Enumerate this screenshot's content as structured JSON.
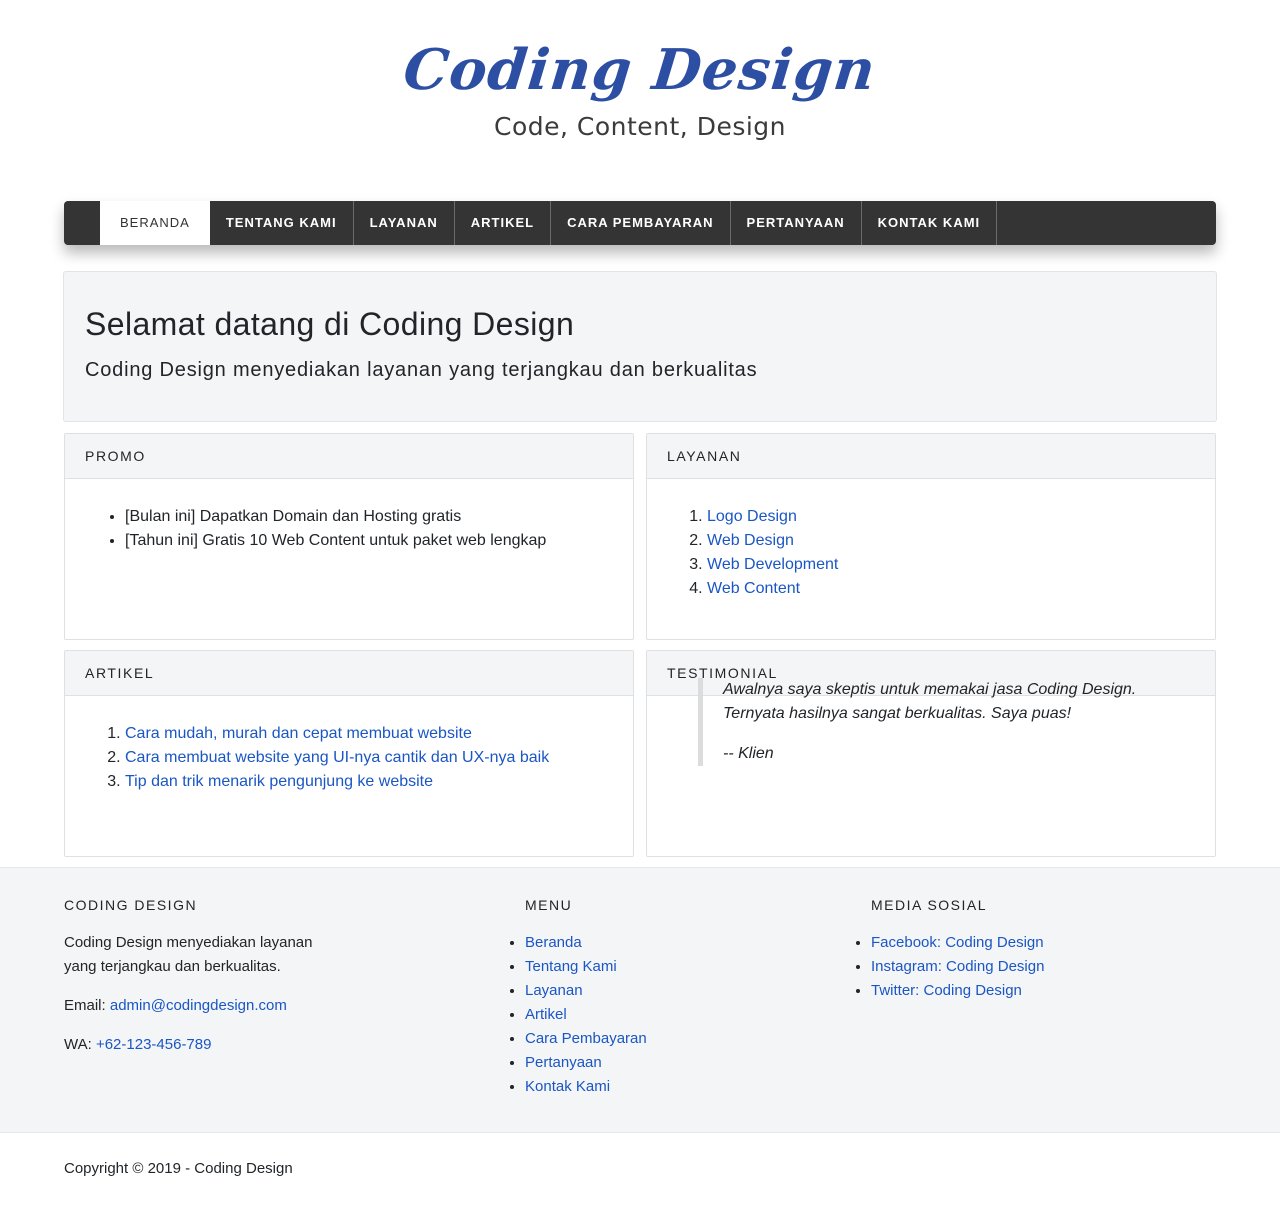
{
  "brand": {
    "logo_text": "Coding Design",
    "tagline": "Code, Content, Design"
  },
  "nav": {
    "items": [
      {
        "label": "BERANDA",
        "active": true
      },
      {
        "label": "TENTANG KAMI"
      },
      {
        "label": "LAYANAN"
      },
      {
        "label": "ARTIKEL"
      },
      {
        "label": "CARA PEMBAYARAN"
      },
      {
        "label": "PERTANYAAN"
      },
      {
        "label": "KONTAK KAMI"
      }
    ]
  },
  "hero": {
    "title": "Selamat datang di Coding Design",
    "subtitle": "Coding Design menyediakan layanan yang terjangkau dan berkualitas"
  },
  "promo": {
    "heading": "PROMO",
    "items": [
      "[Bulan ini] Dapatkan Domain dan Hosting gratis",
      "[Tahun ini] Gratis 10 Web Content untuk paket web lengkap"
    ]
  },
  "layanan": {
    "heading": "LAYANAN",
    "items": [
      "Logo Design",
      "Web Design",
      "Web Development",
      "Web Content"
    ]
  },
  "artikel": {
    "heading": "ARTIKEL",
    "items": [
      "Cara mudah, murah dan cepat membuat website",
      "Cara membuat website yang UI-nya cantik dan UX-nya baik",
      "Tip dan trik menarik pengunjung ke website"
    ]
  },
  "testimonial": {
    "heading": "TESTIMONIAL",
    "line1": "Awalnya saya skeptis untuk memakai jasa Coding Design.",
    "line2": "Ternyata hasilnya sangat berkualitas. Saya puas!",
    "author": "-- Klien"
  },
  "footer": {
    "about": {
      "heading": "CODING DESIGN",
      "line1": "Coding Design menyediakan layanan",
      "line2": "yang terjangkau dan berkualitas.",
      "email_label": "Email:",
      "email": "admin@codingdesign.com",
      "wa_label": "WA:",
      "wa": "+62-123-456-789"
    },
    "menu": {
      "heading": "MENU",
      "items": [
        "Beranda",
        "Tentang Kami",
        "Layanan",
        "Artikel",
        "Cara Pembayaran",
        "Pertanyaan",
        "Kontak Kami"
      ]
    },
    "social": {
      "heading": "MEDIA SOSIAL",
      "items": [
        "Facebook: Coding Design",
        "Instagram: Coding Design",
        "Twitter: Coding Design"
      ]
    }
  },
  "copyright": "Copyright © 2019 - Coding Design",
  "colors": {
    "link": "#1a56c4",
    "nav_bg": "#343434",
    "logo": "#2c4ea3",
    "panel_bg": "#f4f5f7"
  }
}
